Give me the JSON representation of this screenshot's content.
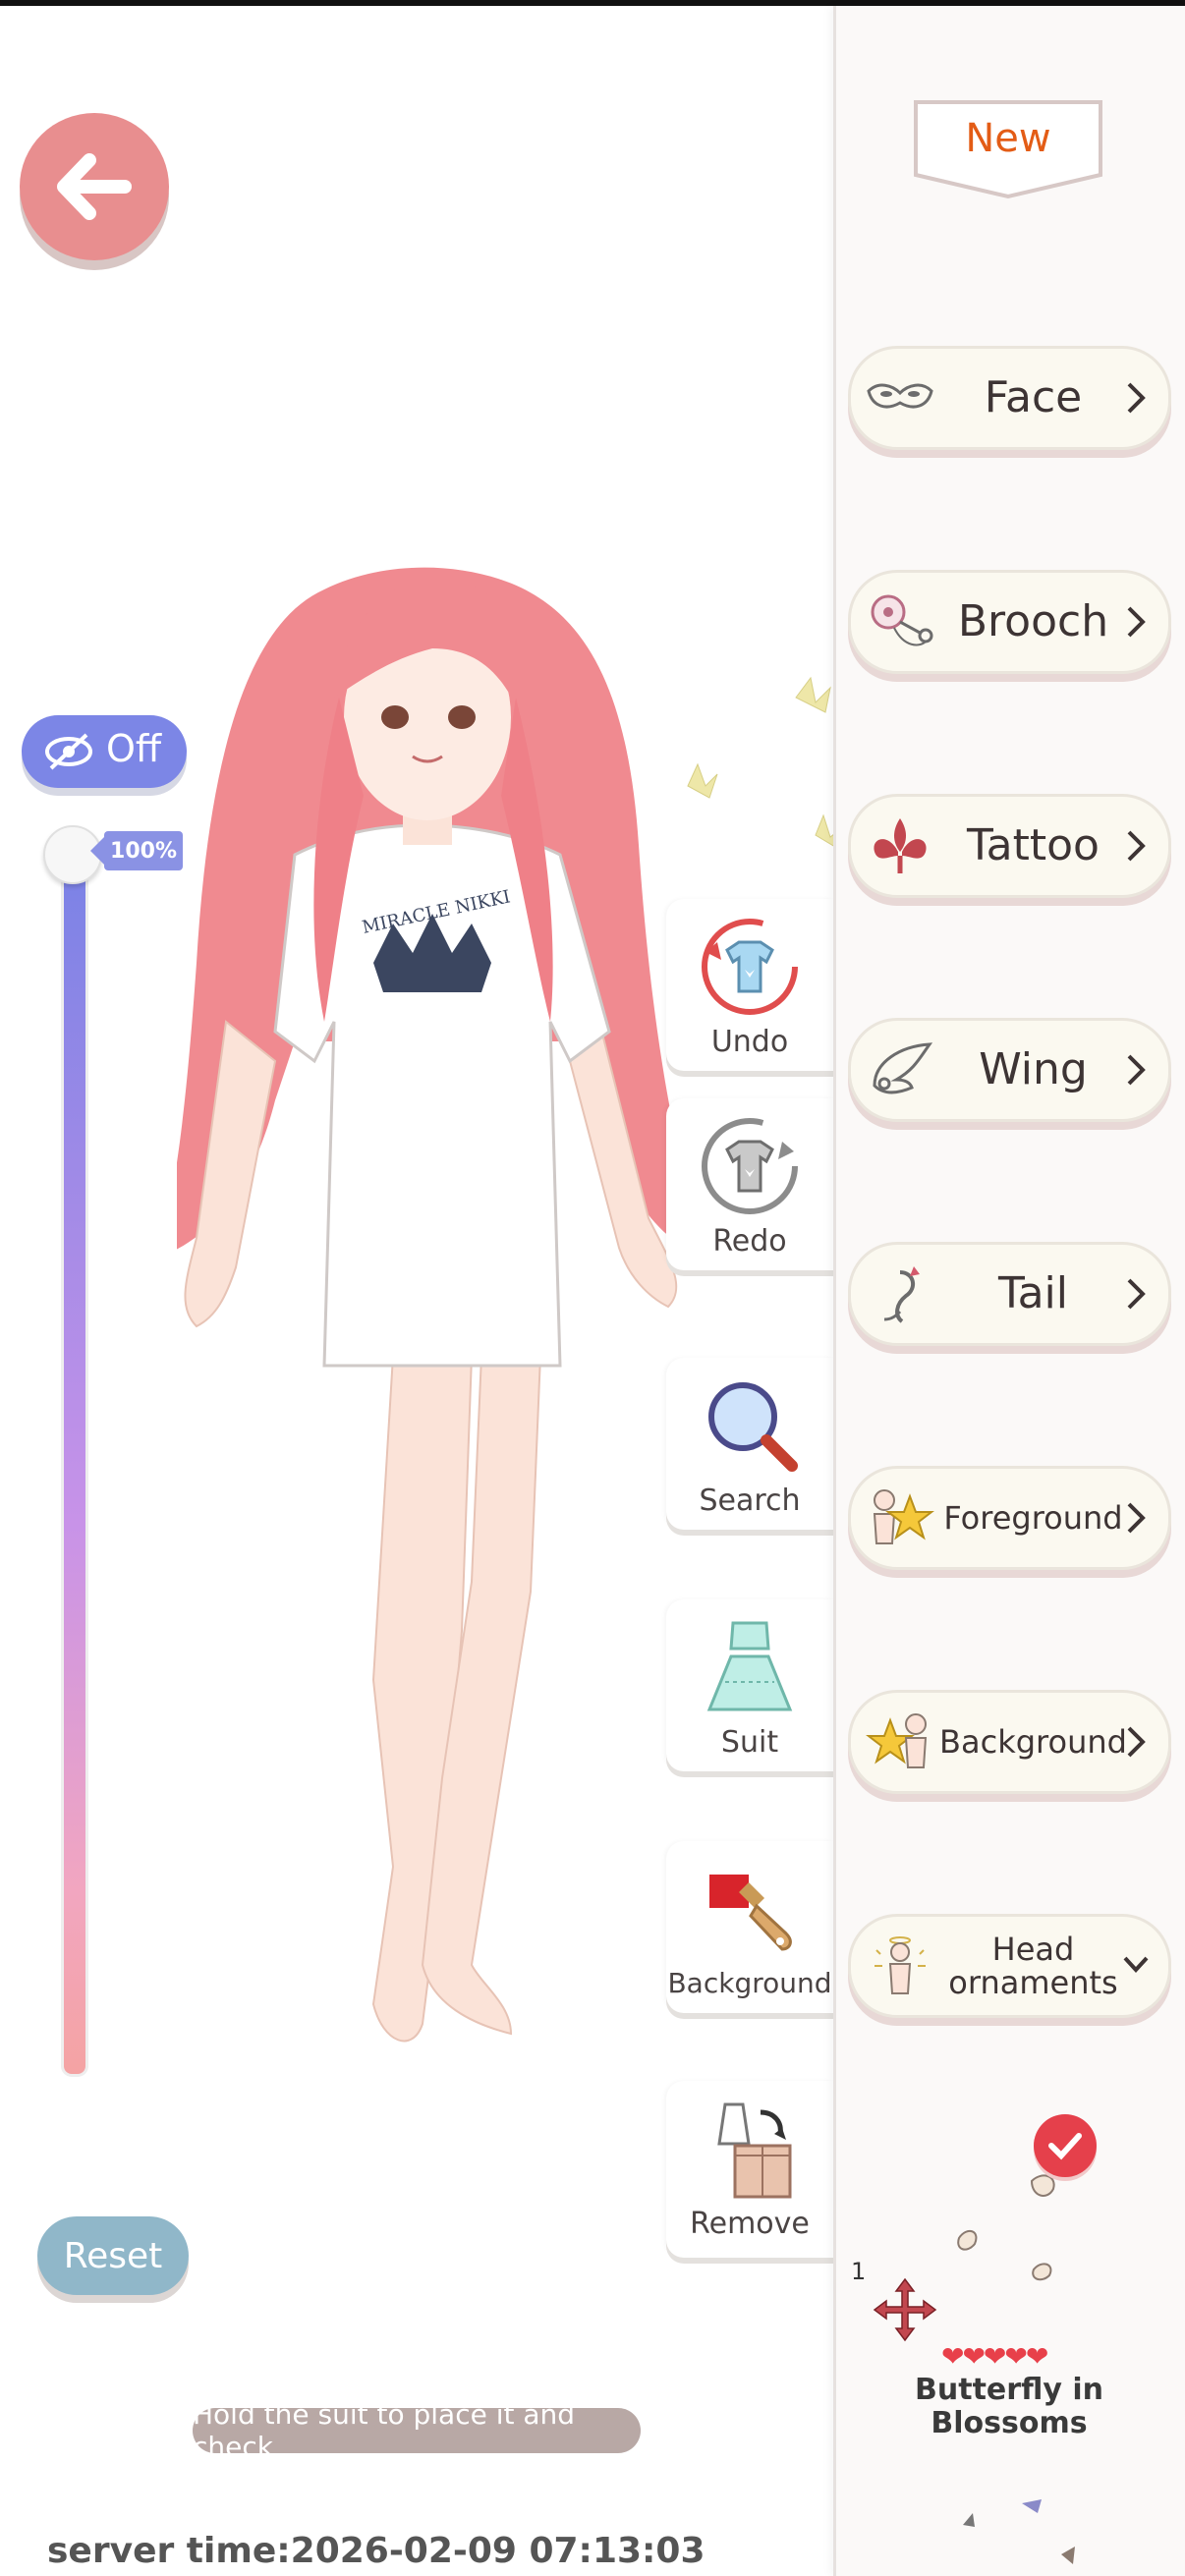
{
  "header": {
    "new_tab_label": "New"
  },
  "categories": [
    {
      "label": "Face",
      "icon": "mask-icon",
      "chevron": "right"
    },
    {
      "label": "Brooch",
      "icon": "brooch-icon",
      "chevron": "right"
    },
    {
      "label": "Tattoo",
      "icon": "fleur-icon",
      "chevron": "right"
    },
    {
      "label": "Wing",
      "icon": "wing-icon",
      "chevron": "right"
    },
    {
      "label": "Tail",
      "icon": "tail-icon",
      "chevron": "right"
    },
    {
      "label": "Foreground",
      "icon": "star-figure-icon",
      "chevron": "right"
    },
    {
      "label": "Background",
      "icon": "star-figure-icon",
      "chevron": "right"
    },
    {
      "label": "Head ornaments",
      "icon": "angel-figure-icon",
      "chevron": "down"
    }
  ],
  "tools": {
    "undo": "Undo",
    "redo": "Redo",
    "search": "Search",
    "suit": "Suit",
    "background": "Background",
    "remove": "Remove"
  },
  "toggle": {
    "label": "Off"
  },
  "slider": {
    "percent_label": "100%",
    "value": 1.0
  },
  "reset_label": "Reset",
  "hint": "Hold the suit to place it and check",
  "server_time": "server time:2026-02-09 07:13:03",
  "item": {
    "count": "1",
    "hearts": "❤❤❤❤❤",
    "name": "Butterfly in Blossoms"
  },
  "colors": {
    "accent_pink": "#e88e8f",
    "new_orange": "#e35c16",
    "toggle_blue": "#7c86e6",
    "reset_blue": "#90b7c9",
    "check_red": "#e5404b"
  }
}
